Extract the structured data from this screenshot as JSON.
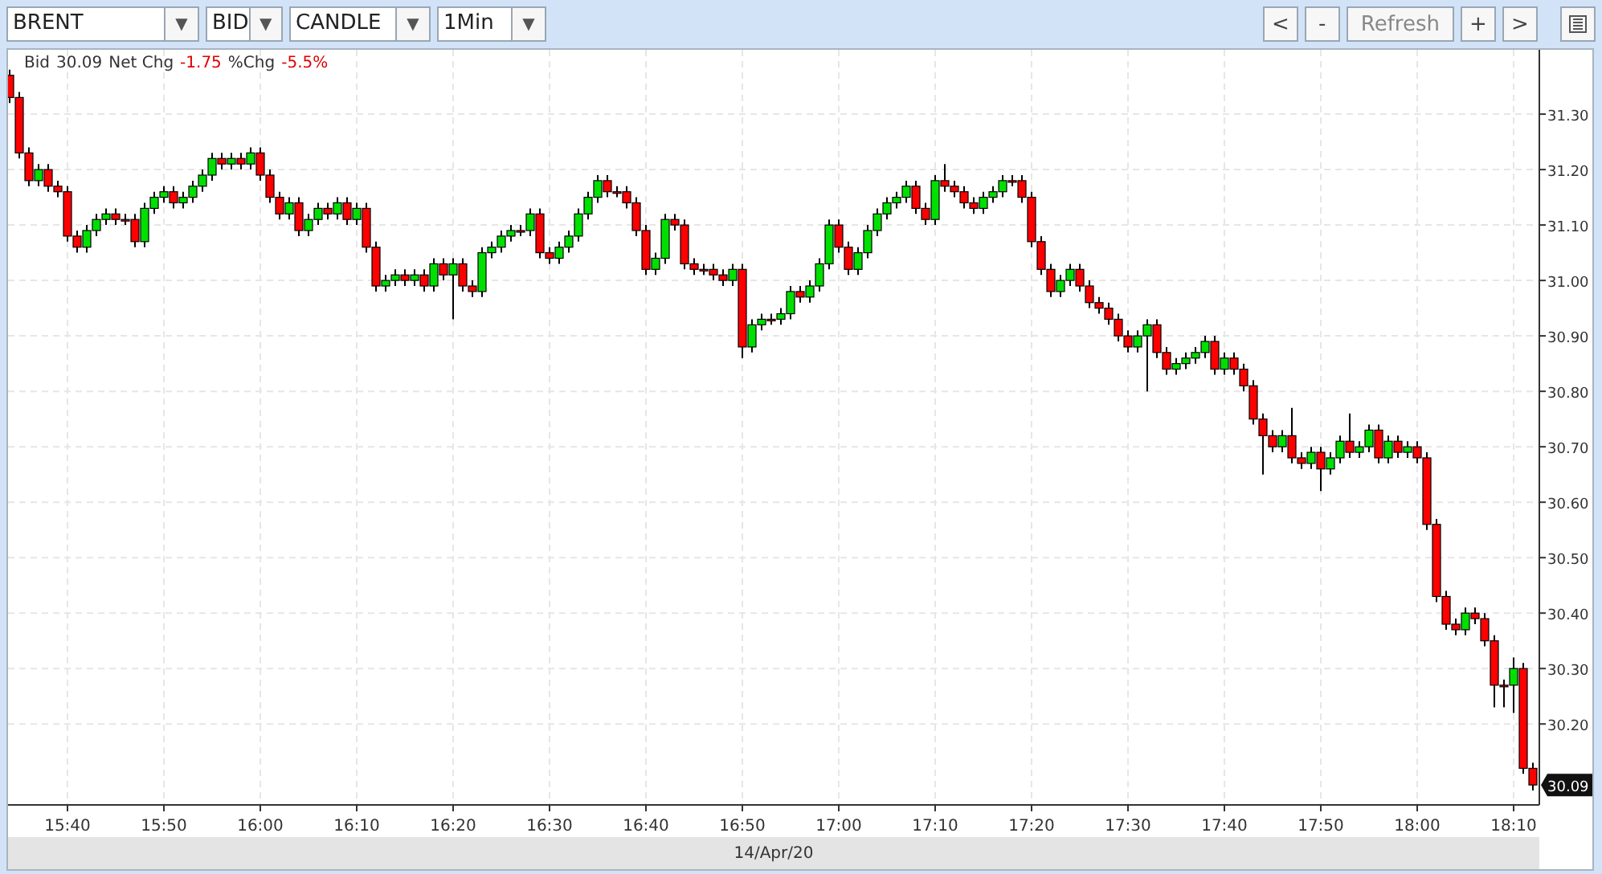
{
  "toolbar": {
    "selects": [
      {
        "value": "BRENT",
        "caret": "▼"
      },
      {
        "value": "BID",
        "caret": "▼"
      },
      {
        "value": "CANDLE",
        "caret": "▼"
      },
      {
        "value": "1Min",
        "caret": "▼"
      }
    ],
    "buttons": [
      "<",
      "-",
      "Refresh",
      "+",
      ">"
    ]
  },
  "chart": {
    "header": {
      "bid_label": "Bid",
      "bid": "30.09",
      "net_chg_label": "Net Chg",
      "net_chg": "-1.75",
      "pct_chg_label": "%Chg",
      "pct_chg": "-5.5%"
    },
    "last_price": "30.09",
    "date": "14/Apr/20",
    "chart_data": {
      "type": "candlestick",
      "grid": true,
      "categories": [
        null,
        null,
        null,
        null,
        null,
        null,
        "15:40",
        null,
        null,
        null,
        null,
        null,
        null,
        null,
        null,
        null,
        "15:50",
        null,
        null,
        null,
        null,
        null,
        null,
        null,
        null,
        null,
        "16:00",
        null,
        null,
        null,
        null,
        null,
        null,
        null,
        null,
        null,
        "16:10",
        null,
        null,
        null,
        null,
        null,
        null,
        null,
        null,
        null,
        "16:20",
        null,
        null,
        null,
        null,
        null,
        null,
        null,
        null,
        null,
        "16:30",
        null,
        null,
        null,
        null,
        null,
        null,
        null,
        null,
        null,
        "16:40",
        null,
        null,
        null,
        null,
        null,
        null,
        null,
        null,
        null,
        "16:50",
        null,
        null,
        null,
        null,
        null,
        null,
        null,
        null,
        null,
        "17:00",
        null,
        null,
        null,
        null,
        null,
        null,
        null,
        null,
        null,
        "17:10",
        null,
        null,
        null,
        null,
        null,
        null,
        null,
        null,
        null,
        "17:20",
        null,
        null,
        null,
        null,
        null,
        null,
        null,
        null,
        null,
        "17:30",
        null,
        null,
        null,
        null,
        null,
        null,
        null,
        null,
        null,
        "17:40",
        null,
        null,
        null,
        null,
        null,
        null,
        null,
        null,
        null,
        "17:50",
        null,
        null,
        null,
        null,
        null,
        null,
        null,
        null,
        null,
        "18:00",
        null,
        null,
        null,
        null,
        null,
        null,
        null,
        null,
        null,
        "18:10",
        null,
        null
      ],
      "ohlc": [
        [
          31.37,
          31.38,
          31.32,
          31.33
        ],
        [
          31.33,
          31.34,
          31.22,
          31.23
        ],
        [
          31.23,
          31.24,
          31.17,
          31.18
        ],
        [
          31.18,
          31.21,
          31.17,
          31.2
        ],
        [
          31.2,
          31.21,
          31.16,
          31.17
        ],
        [
          31.17,
          31.18,
          31.15,
          31.16
        ],
        [
          31.16,
          31.17,
          31.07,
          31.08
        ],
        [
          31.08,
          31.09,
          31.05,
          31.06
        ],
        [
          31.06,
          31.1,
          31.05,
          31.09
        ],
        [
          31.09,
          31.12,
          31.08,
          31.11
        ],
        [
          31.11,
          31.13,
          31.1,
          31.12
        ],
        [
          31.12,
          31.13,
          31.1,
          31.11
        ],
        [
          31.11,
          31.12,
          31.1,
          31.11
        ],
        [
          31.11,
          31.12,
          31.06,
          31.07
        ],
        [
          31.07,
          31.14,
          31.06,
          31.13
        ],
        [
          31.13,
          31.16,
          31.12,
          31.15
        ],
        [
          31.15,
          31.17,
          31.14,
          31.16
        ],
        [
          31.16,
          31.17,
          31.13,
          31.14
        ],
        [
          31.14,
          31.16,
          31.13,
          31.15
        ],
        [
          31.15,
          31.18,
          31.14,
          31.17
        ],
        [
          31.17,
          31.2,
          31.16,
          31.19
        ],
        [
          31.19,
          31.23,
          31.18,
          31.22
        ],
        [
          31.22,
          31.23,
          31.2,
          31.21
        ],
        [
          31.21,
          31.23,
          31.2,
          31.22
        ],
        [
          31.22,
          31.23,
          31.2,
          31.21
        ],
        [
          31.21,
          31.24,
          31.2,
          31.23
        ],
        [
          31.23,
          31.24,
          31.18,
          31.19
        ],
        [
          31.19,
          31.2,
          31.14,
          31.15
        ],
        [
          31.15,
          31.16,
          31.11,
          31.12
        ],
        [
          31.12,
          31.15,
          31.11,
          31.14
        ],
        [
          31.14,
          31.15,
          31.08,
          31.09
        ],
        [
          31.09,
          31.12,
          31.08,
          31.11
        ],
        [
          31.11,
          31.14,
          31.1,
          31.13
        ],
        [
          31.13,
          31.14,
          31.11,
          31.12
        ],
        [
          31.12,
          31.15,
          31.11,
          31.14
        ],
        [
          31.14,
          31.15,
          31.1,
          31.11
        ],
        [
          31.11,
          31.14,
          31.1,
          31.13
        ],
        [
          31.13,
          31.14,
          31.05,
          31.06
        ],
        [
          31.06,
          31.07,
          30.98,
          30.99
        ],
        [
          30.99,
          31.01,
          30.98,
          31.0
        ],
        [
          31.0,
          31.02,
          30.99,
          31.01
        ],
        [
          31.01,
          31.02,
          30.99,
          31.0
        ],
        [
          31.0,
          31.02,
          30.99,
          31.01
        ],
        [
          31.01,
          31.02,
          30.98,
          30.99
        ],
        [
          30.99,
          31.04,
          30.98,
          31.03
        ],
        [
          31.03,
          31.04,
          31.0,
          31.01
        ],
        [
          31.01,
          31.04,
          30.93,
          31.03
        ],
        [
          31.03,
          31.04,
          30.98,
          30.99
        ],
        [
          30.99,
          31.0,
          30.97,
          30.98
        ],
        [
          30.98,
          31.06,
          30.97,
          31.05
        ],
        [
          31.05,
          31.07,
          31.04,
          31.06
        ],
        [
          31.06,
          31.09,
          31.05,
          31.08
        ],
        [
          31.08,
          31.1,
          31.07,
          31.09
        ],
        [
          31.09,
          31.1,
          31.08,
          31.09
        ],
        [
          31.09,
          31.13,
          31.08,
          31.12
        ],
        [
          31.12,
          31.13,
          31.04,
          31.05
        ],
        [
          31.05,
          31.06,
          31.03,
          31.04
        ],
        [
          31.04,
          31.07,
          31.03,
          31.06
        ],
        [
          31.06,
          31.09,
          31.05,
          31.08
        ],
        [
          31.08,
          31.13,
          31.07,
          31.12
        ],
        [
          31.12,
          31.16,
          31.11,
          31.15
        ],
        [
          31.15,
          31.19,
          31.14,
          31.18
        ],
        [
          31.18,
          31.19,
          31.15,
          31.16
        ],
        [
          31.16,
          31.17,
          31.15,
          31.16
        ],
        [
          31.16,
          31.17,
          31.13,
          31.14
        ],
        [
          31.14,
          31.15,
          31.08,
          31.09
        ],
        [
          31.09,
          31.1,
          31.01,
          31.02
        ],
        [
          31.02,
          31.05,
          31.01,
          31.04
        ],
        [
          31.04,
          31.12,
          31.03,
          31.11
        ],
        [
          31.11,
          31.12,
          31.09,
          31.1
        ],
        [
          31.1,
          31.11,
          31.02,
          31.03
        ],
        [
          31.03,
          31.04,
          31.01,
          31.02
        ],
        [
          31.02,
          31.03,
          31.01,
          31.02
        ],
        [
          31.02,
          31.03,
          31.0,
          31.01
        ],
        [
          31.01,
          31.02,
          30.99,
          31.0
        ],
        [
          31.0,
          31.03,
          30.99,
          31.02
        ],
        [
          31.02,
          31.03,
          30.86,
          30.88
        ],
        [
          30.88,
          30.93,
          30.87,
          30.92
        ],
        [
          30.92,
          30.94,
          30.91,
          30.93
        ],
        [
          30.93,
          30.94,
          30.92,
          30.93
        ],
        [
          30.93,
          30.95,
          30.92,
          30.94
        ],
        [
          30.94,
          30.99,
          30.93,
          30.98
        ],
        [
          30.98,
          30.99,
          30.96,
          30.97
        ],
        [
          30.97,
          31.0,
          30.96,
          30.99
        ],
        [
          30.99,
          31.04,
          30.98,
          31.03
        ],
        [
          31.03,
          31.11,
          31.02,
          31.1
        ],
        [
          31.1,
          31.11,
          31.05,
          31.06
        ],
        [
          31.06,
          31.07,
          31.01,
          31.02
        ],
        [
          31.02,
          31.06,
          31.01,
          31.05
        ],
        [
          31.05,
          31.1,
          31.04,
          31.09
        ],
        [
          31.09,
          31.13,
          31.08,
          31.12
        ],
        [
          31.12,
          31.15,
          31.11,
          31.14
        ],
        [
          31.14,
          31.16,
          31.13,
          31.15
        ],
        [
          31.15,
          31.18,
          31.14,
          31.17
        ],
        [
          31.17,
          31.18,
          31.12,
          31.13
        ],
        [
          31.13,
          31.14,
          31.1,
          31.11
        ],
        [
          31.11,
          31.19,
          31.1,
          31.18
        ],
        [
          31.18,
          31.21,
          31.16,
          31.17
        ],
        [
          31.17,
          31.18,
          31.15,
          31.16
        ],
        [
          31.16,
          31.17,
          31.13,
          31.14
        ],
        [
          31.14,
          31.15,
          31.12,
          31.13
        ],
        [
          31.13,
          31.16,
          31.12,
          31.15
        ],
        [
          31.15,
          31.17,
          31.14,
          31.16
        ],
        [
          31.16,
          31.19,
          31.15,
          31.18
        ],
        [
          31.18,
          31.19,
          31.17,
          31.18
        ],
        [
          31.18,
          31.19,
          31.14,
          31.15
        ],
        [
          31.15,
          31.16,
          31.06,
          31.07
        ],
        [
          31.07,
          31.08,
          31.01,
          31.02
        ],
        [
          31.02,
          31.03,
          30.97,
          30.98
        ],
        [
          30.98,
          31.01,
          30.97,
          31.0
        ],
        [
          31.0,
          31.03,
          30.99,
          31.02
        ],
        [
          31.02,
          31.03,
          30.98,
          30.99
        ],
        [
          30.99,
          31.0,
          30.95,
          30.96
        ],
        [
          30.96,
          30.97,
          30.94,
          30.95
        ],
        [
          30.95,
          30.96,
          30.92,
          30.93
        ],
        [
          30.93,
          30.94,
          30.89,
          30.9
        ],
        [
          30.9,
          30.91,
          30.87,
          30.88
        ],
        [
          30.88,
          30.91,
          30.87,
          30.9
        ],
        [
          30.9,
          30.93,
          30.8,
          30.92
        ],
        [
          30.92,
          30.93,
          30.86,
          30.87
        ],
        [
          30.87,
          30.88,
          30.83,
          30.84
        ],
        [
          30.84,
          30.86,
          30.83,
          30.85
        ],
        [
          30.85,
          30.87,
          30.84,
          30.86
        ],
        [
          30.86,
          30.88,
          30.85,
          30.87
        ],
        [
          30.87,
          30.9,
          30.86,
          30.89
        ],
        [
          30.89,
          30.9,
          30.83,
          30.84
        ],
        [
          30.84,
          30.87,
          30.83,
          30.86
        ],
        [
          30.86,
          30.87,
          30.83,
          30.84
        ],
        [
          30.84,
          30.85,
          30.8,
          30.81
        ],
        [
          30.81,
          30.82,
          30.74,
          30.75
        ],
        [
          30.75,
          30.76,
          30.65,
          30.72
        ],
        [
          30.72,
          30.73,
          30.69,
          30.7
        ],
        [
          30.7,
          30.73,
          30.69,
          30.72
        ],
        [
          30.72,
          30.77,
          30.67,
          30.68
        ],
        [
          30.68,
          30.69,
          30.66,
          30.67
        ],
        [
          30.67,
          30.7,
          30.66,
          30.69
        ],
        [
          30.69,
          30.7,
          30.62,
          30.66
        ],
        [
          30.66,
          30.69,
          30.65,
          30.68
        ],
        [
          30.68,
          30.72,
          30.67,
          30.71
        ],
        [
          30.71,
          30.76,
          30.68,
          30.69
        ],
        [
          30.69,
          30.71,
          30.68,
          30.7
        ],
        [
          30.7,
          30.74,
          30.69,
          30.73
        ],
        [
          30.73,
          30.74,
          30.67,
          30.68
        ],
        [
          30.68,
          30.72,
          30.67,
          30.71
        ],
        [
          30.71,
          30.72,
          30.68,
          30.69
        ],
        [
          30.69,
          30.71,
          30.68,
          30.7
        ],
        [
          30.7,
          30.71,
          30.67,
          30.68
        ],
        [
          30.68,
          30.69,
          30.55,
          30.56
        ],
        [
          30.56,
          30.57,
          30.42,
          30.43
        ],
        [
          30.43,
          30.44,
          30.37,
          30.38
        ],
        [
          30.38,
          30.39,
          30.36,
          30.37
        ],
        [
          30.37,
          30.41,
          30.36,
          30.4
        ],
        [
          30.4,
          30.41,
          30.38,
          30.39
        ],
        [
          30.39,
          30.4,
          30.34,
          30.35
        ],
        [
          30.35,
          30.36,
          30.23,
          30.27
        ],
        [
          30.27,
          30.28,
          30.23,
          30.27
        ],
        [
          30.27,
          30.32,
          30.22,
          30.3
        ],
        [
          30.3,
          30.31,
          30.11,
          30.12
        ],
        [
          30.12,
          30.13,
          30.08,
          30.09
        ]
      ],
      "ylim": [
        30.054,
        31.416
      ],
      "yticks": [
        {
          "value": 30.2,
          "label": "30.20"
        },
        {
          "value": 30.3,
          "label": "30.30"
        },
        {
          "value": 30.4,
          "label": "30.40"
        },
        {
          "value": 30.5,
          "label": "30.50"
        },
        {
          "value": 30.6,
          "label": "30.60"
        },
        {
          "value": 30.7,
          "label": "30.70"
        },
        {
          "value": 30.8,
          "label": "30.80"
        },
        {
          "value": 30.9,
          "label": "30.90"
        },
        {
          "value": 31.0,
          "label": "31.00"
        },
        {
          "value": 31.1,
          "label": "31.10"
        },
        {
          "value": 31.2,
          "label": "31.20"
        },
        {
          "value": 31.3,
          "label": "31.30"
        }
      ]
    }
  }
}
